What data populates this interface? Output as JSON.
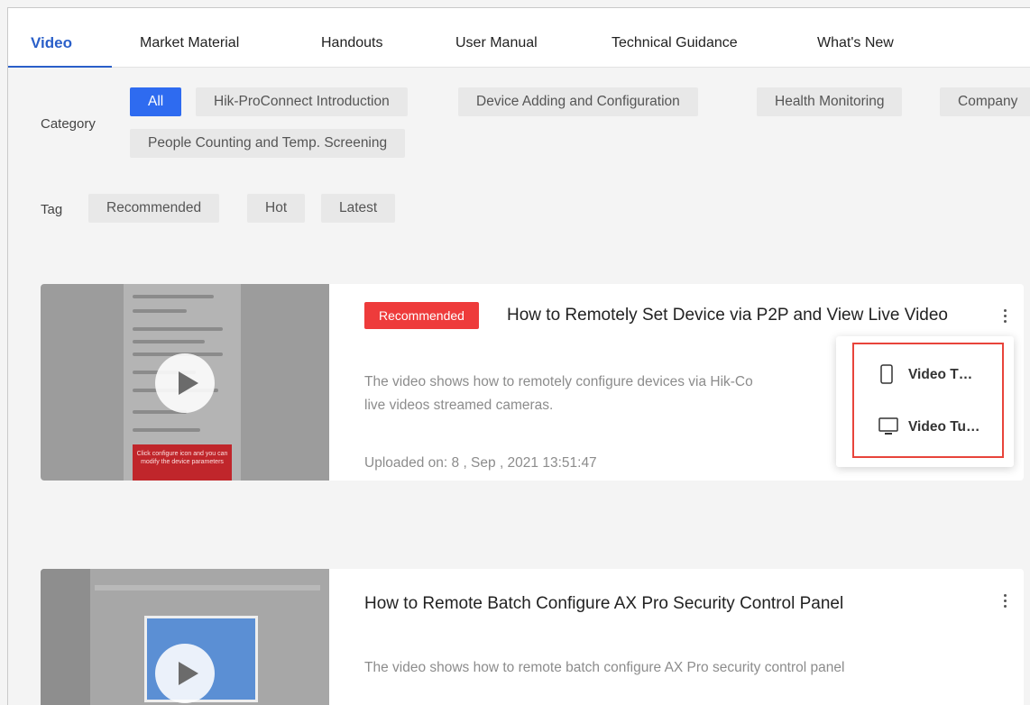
{
  "tabs": [
    {
      "label": "Video"
    },
    {
      "label": "Market Material"
    },
    {
      "label": "Handouts"
    },
    {
      "label": "User Manual"
    },
    {
      "label": "Technical Guidance"
    },
    {
      "label": "What's New"
    }
  ],
  "filters": {
    "category_label": "Category",
    "categories": [
      "All",
      "Hik-ProConnect Introduction",
      "Device Adding and Configuration",
      "Health Monitoring",
      "Company",
      "People Counting and Temp. Screening"
    ],
    "tag_label": "Tag",
    "tags": [
      "Recommended",
      "Hot",
      "Latest"
    ]
  },
  "videos": [
    {
      "badge": "Recommended",
      "title": "How to Remotely Set Device via P2P and View Live Video",
      "description": "The video shows how to remotely configure devices via Hik-Co… live videos streamed cameras.",
      "desc_line1": "The video shows how to remotely configure devices via Hik-Co",
      "desc_line2": "live videos streamed cameras.",
      "uploaded": "Uploaded on: 8 , Sep , 2021 13:51:47",
      "thumb_text": "Click configure icon and you can modify the device parameters"
    },
    {
      "title": "How to Remote Batch Configure AX Pro Security Control Panel",
      "description": "The video shows how to remote batch configure AX Pro security control panel"
    }
  ],
  "context_menu": {
    "items": [
      {
        "label": "Video T…",
        "icon": "mobile-icon"
      },
      {
        "label": "Video Tu…",
        "icon": "monitor-icon"
      }
    ]
  },
  "colors": {
    "accent": "#2a5fc9",
    "chip_active": "#2e6bf0",
    "badge": "#ee3b3b",
    "highlight": "#e8443b"
  }
}
